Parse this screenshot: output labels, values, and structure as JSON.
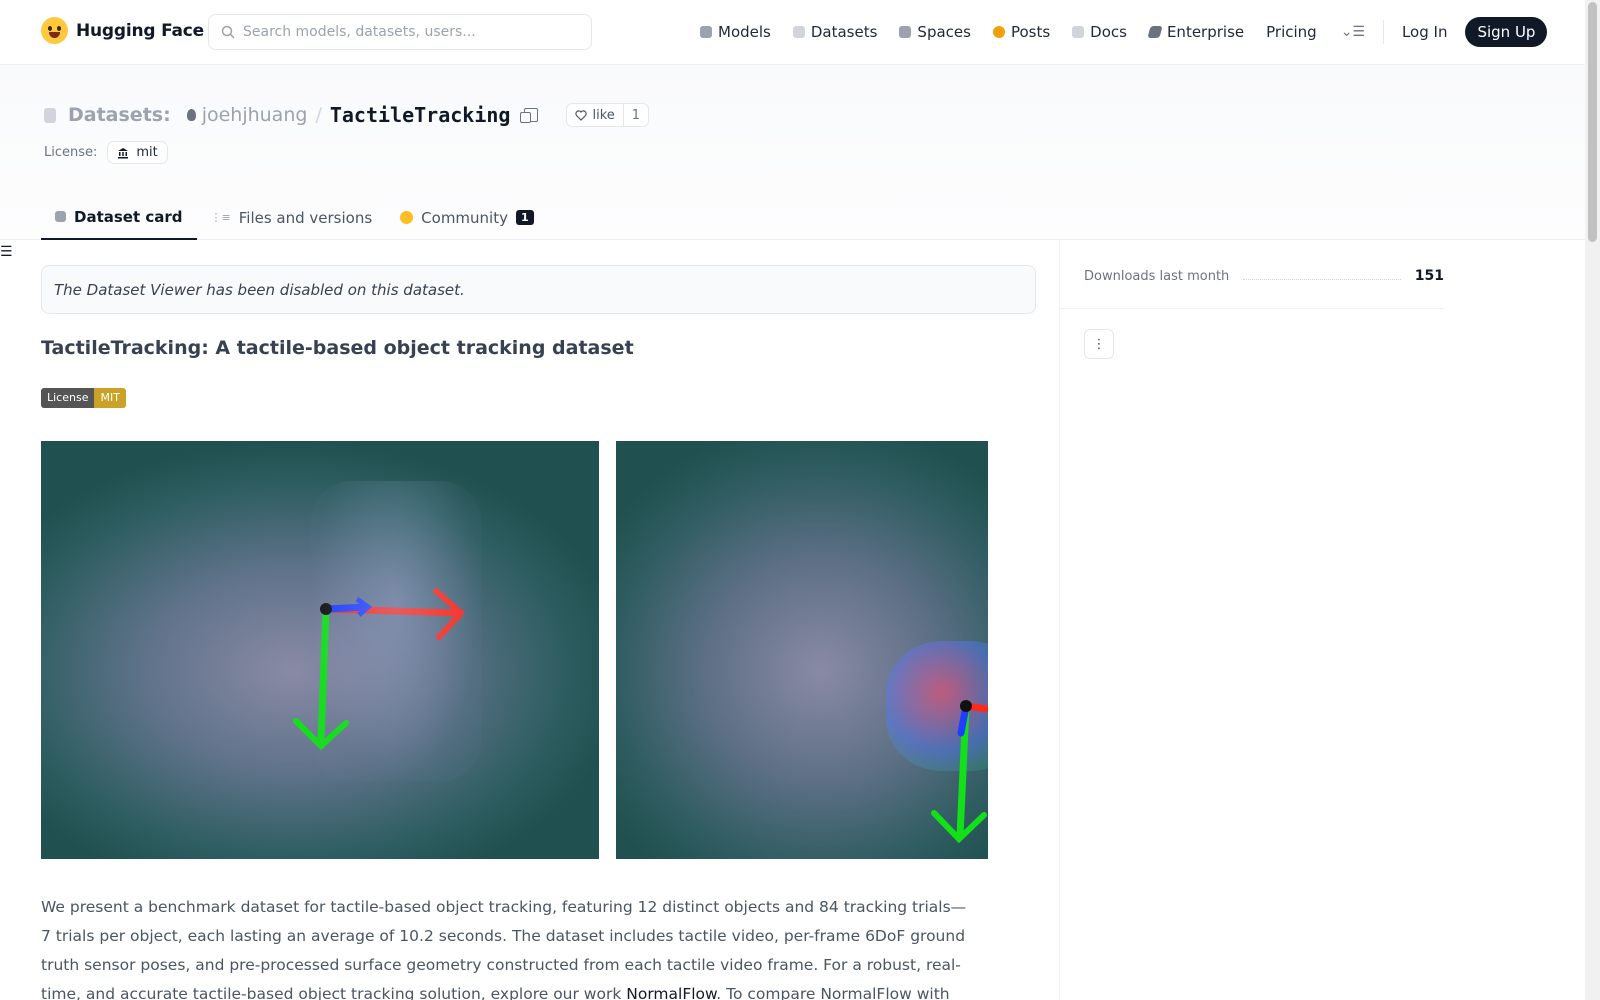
{
  "brand": {
    "name": "Hugging Face"
  },
  "search": {
    "placeholder": "Search models, datasets, users..."
  },
  "nav": {
    "links": [
      {
        "label": "Models",
        "color": "#9ca3af"
      },
      {
        "label": "Datasets",
        "color": "#d1d5db"
      },
      {
        "label": "Spaces",
        "color": "#9ca3af"
      },
      {
        "label": "Posts",
        "color": "#f59e0b"
      },
      {
        "label": "Docs",
        "color": "#d1d5db"
      },
      {
        "label": "Enterprise",
        "color": "#6b7280"
      },
      {
        "label": "Pricing",
        "color": ""
      }
    ],
    "login": "Log In",
    "signup": "Sign Up"
  },
  "repo": {
    "type_label": "Datasets:",
    "owner": "joehjhuang",
    "name": "TactileTracking",
    "like_label": "like",
    "like_count": "1",
    "license_label": "License:",
    "license_value": "mit"
  },
  "tabs": [
    {
      "label": "Dataset card",
      "icon": "dataset-card-icon"
    },
    {
      "label": "Files and versions",
      "icon": "files-icon"
    },
    {
      "label": "Community",
      "icon": "community-icon",
      "badge": "1"
    }
  ],
  "main": {
    "viewer_note": "The Dataset Viewer has been disabled on this dataset.",
    "title": "TactileTracking: A tactile-based object tracking dataset",
    "badge": {
      "left": "License",
      "right": "MIT",
      "right_color": "#c9a227"
    },
    "description_before": "We present a benchmark dataset for tactile-based object tracking, featuring 12 distinct objects and 84 tracking trials—7 trials per object, each lasting an average of 10.2 seconds. The dataset includes tactile video, per-frame 6DoF ground truth sensor poses, and pre-processed surface geometry constructed from each tactile video frame. For a robust, real-time, and accurate tactile-based object tracking solution, explore our work ",
    "description_link": "NormalFlow",
    "description_after": ". To compare NormalFlow with other methods on this dataset, use the"
  },
  "sidebar": {
    "downloads_label": "Downloads last month",
    "downloads_value": "151"
  }
}
